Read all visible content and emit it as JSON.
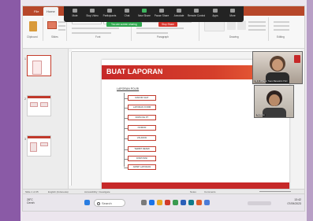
{
  "ribbon": {
    "tabs": [
      "File",
      "Home"
    ],
    "groups": [
      "Clipboard",
      "Slides",
      "Font",
      "Paragraph",
      "Drawing",
      "Editing"
    ]
  },
  "zoom_toolbar": {
    "items": [
      "Mute",
      "Stop Video",
      "Participants",
      "Chat",
      "New Share",
      "Pause Share",
      "Annotate",
      "Remote Control",
      "Apps",
      "More"
    ],
    "sharing_banner": "You are screen sharing",
    "stop_share": "Stop Share"
  },
  "thumbnails": {
    "numbers": [
      "1",
      "2",
      "3"
    ]
  },
  "slide": {
    "title": "BUAT LAPORAN",
    "diagram_title": "LAPORAN POLRI",
    "nodes": [
      "RAKOR GIAT",
      "LAPORAN FORM",
      "KIRIM KE PT",
      "NOMOR",
      "VALIDASI",
      "TERBIT RESMI",
      "DISPOSISI",
      "ARSIP LAPORAN"
    ]
  },
  "video": {
    "tile1_label": "M.A. Wijaya | Team Bareskrim Polri",
    "tile2_label": "Sudarso"
  },
  "statusbar": {
    "slide_info": "Slide 1 of 25",
    "language": "English (Indonesia)",
    "accessibility": "Accessibility: Investigate",
    "notes": "Notes",
    "comments": "Comments"
  },
  "taskbar": {
    "weather_temp": "28°C",
    "weather_desc": "Cerah",
    "search_placeholder": "Search",
    "time": "13:42",
    "date": "07/09/2023"
  }
}
